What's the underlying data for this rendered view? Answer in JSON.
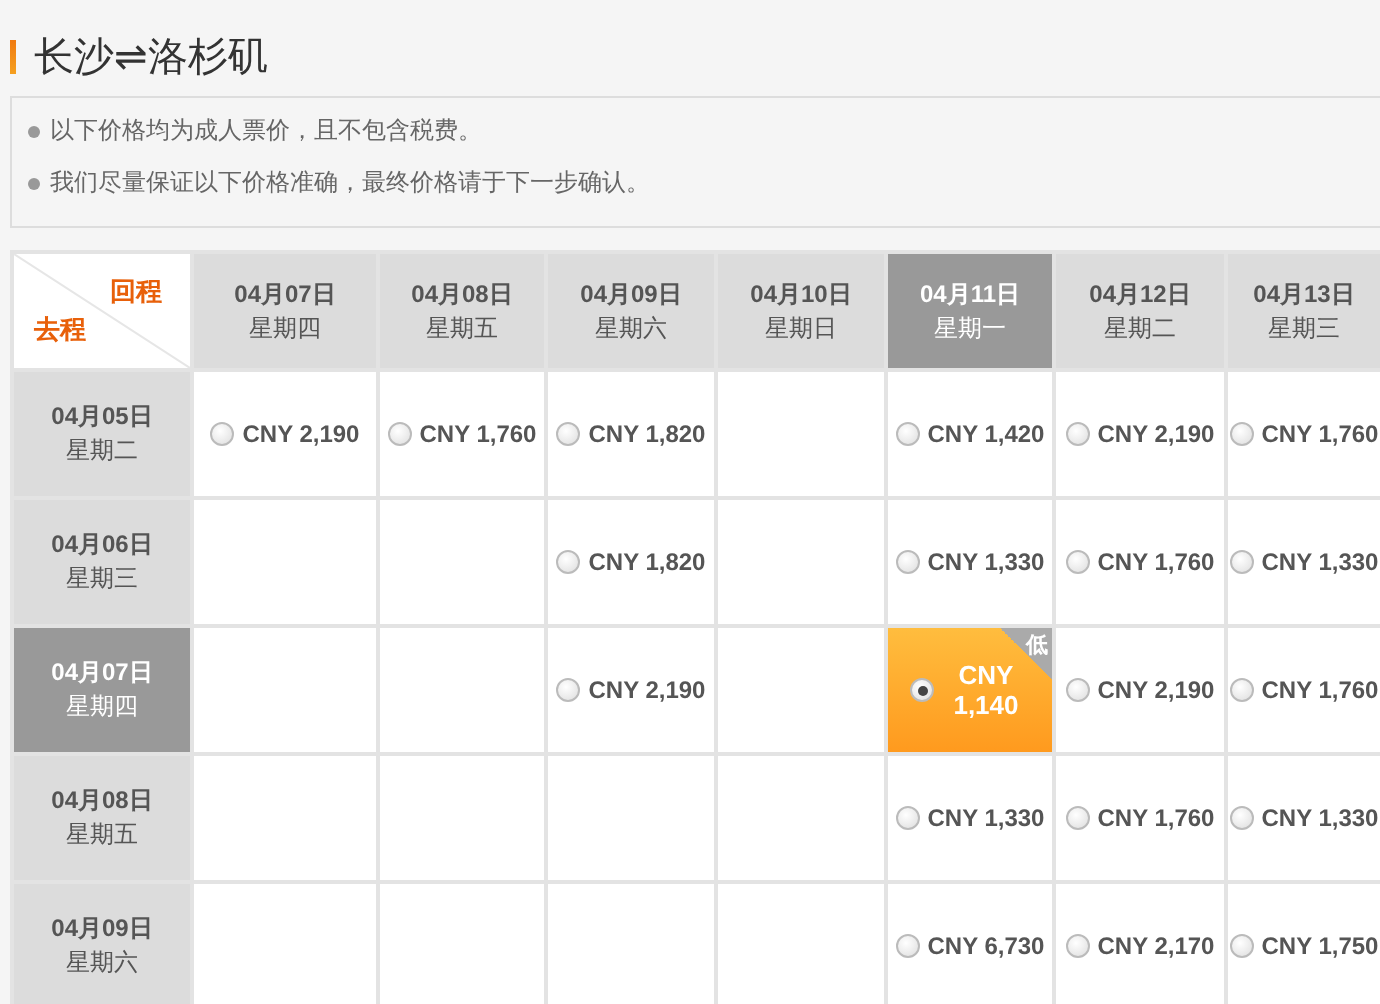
{
  "title": "长沙⇌洛杉矶",
  "notes": [
    "以下价格均为成人票价，且不包含税费。",
    "我们尽量保证以下价格准确，最终价格请于下一步确认。"
  ],
  "corner": {
    "return_label": "回程",
    "depart_label": "去程"
  },
  "columns": [
    {
      "date": "04月07日",
      "weekday": "星期四",
      "selected": false
    },
    {
      "date": "04月08日",
      "weekday": "星期五",
      "selected": false
    },
    {
      "date": "04月09日",
      "weekday": "星期六",
      "selected": false
    },
    {
      "date": "04月10日",
      "weekday": "星期日",
      "selected": false
    },
    {
      "date": "04月11日",
      "weekday": "星期一",
      "selected": true
    },
    {
      "date": "04月12日",
      "weekday": "星期二",
      "selected": false
    },
    {
      "date": "04月13日",
      "weekday": "星期三",
      "selected": false
    }
  ],
  "rows": [
    {
      "date": "04月05日",
      "weekday": "星期二",
      "selected": false,
      "cells": [
        {
          "price": "CNY 2,190",
          "selected": false
        },
        {
          "price": "CNY 1,760",
          "selected": false
        },
        {
          "price": "CNY 1,820",
          "selected": false
        },
        null,
        {
          "price": "CNY 1,420",
          "selected": false
        },
        {
          "price": "CNY 2,190",
          "selected": false
        },
        {
          "price": "CNY 1,760",
          "selected": false
        }
      ]
    },
    {
      "date": "04月06日",
      "weekday": "星期三",
      "selected": false,
      "cells": [
        null,
        null,
        {
          "price": "CNY 1,820",
          "selected": false
        },
        null,
        {
          "price": "CNY 1,330",
          "selected": false
        },
        {
          "price": "CNY 1,760",
          "selected": false
        },
        {
          "price": "CNY 1,330",
          "selected": false
        }
      ]
    },
    {
      "date": "04月07日",
      "weekday": "星期四",
      "selected": true,
      "cells": [
        null,
        null,
        {
          "price": "CNY 2,190",
          "selected": false
        },
        null,
        {
          "price": "CNY 1,140",
          "selected": true,
          "badge": "低"
        },
        {
          "price": "CNY 2,190",
          "selected": false
        },
        {
          "price": "CNY 1,760",
          "selected": false
        }
      ]
    },
    {
      "date": "04月08日",
      "weekday": "星期五",
      "selected": false,
      "cells": [
        null,
        null,
        null,
        null,
        {
          "price": "CNY 1,330",
          "selected": false
        },
        {
          "price": "CNY 1,760",
          "selected": false
        },
        {
          "price": "CNY 1,330",
          "selected": false
        }
      ]
    },
    {
      "date": "04月09日",
      "weekday": "星期六",
      "selected": false,
      "cells": [
        null,
        null,
        null,
        null,
        {
          "price": "CNY 6,730",
          "selected": false
        },
        {
          "price": "CNY 2,170",
          "selected": false
        },
        {
          "price": "CNY 1,750",
          "selected": false
        }
      ]
    }
  ]
}
